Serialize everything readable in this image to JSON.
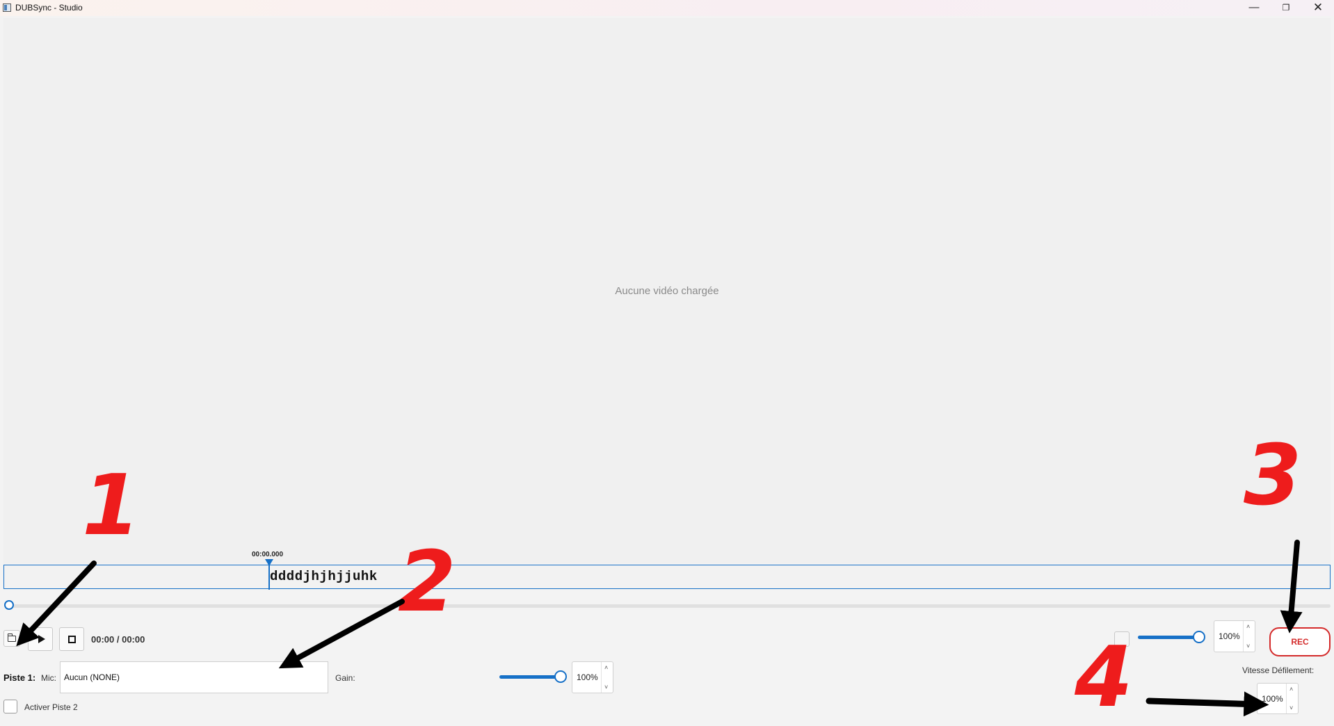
{
  "window": {
    "title": "DUBSync - Studio",
    "minimize_glyph": "—",
    "maximize_glyph": "❐",
    "close_glyph": "✕"
  },
  "video": {
    "placeholder": "Aucune vidéo chargée"
  },
  "timeline": {
    "playhead_timecode": "00:00.000",
    "subtitle_text": "ddddjhjhjjuhk",
    "seek_position": 0
  },
  "transport": {
    "icons": [
      "folder-icon",
      "play-icon",
      "stop-icon"
    ],
    "time_display": "00:00 / 00:00"
  },
  "output": {
    "volume_value": "100%",
    "volume_level": 1.0,
    "rec_label": "REC",
    "rec_color": "#d42a2a"
  },
  "track1": {
    "label": "Piste 1:",
    "mic_label": "Mic:",
    "mic_value": "Aucun (NONE)",
    "gain_label": "Gain:",
    "gain_value": "100%",
    "gain_level": 1.0
  },
  "scroll": {
    "label": "Vitesse Défilement:",
    "value": "100%"
  },
  "track2": {
    "enable_label": "Activer Piste 2",
    "checked": false
  },
  "annotations": [
    "1",
    "2",
    "3",
    "4"
  ],
  "colors": {
    "accent": "#1670c7",
    "annotation_red": "#ee1c1c",
    "annotation_arrow": "#000000"
  }
}
